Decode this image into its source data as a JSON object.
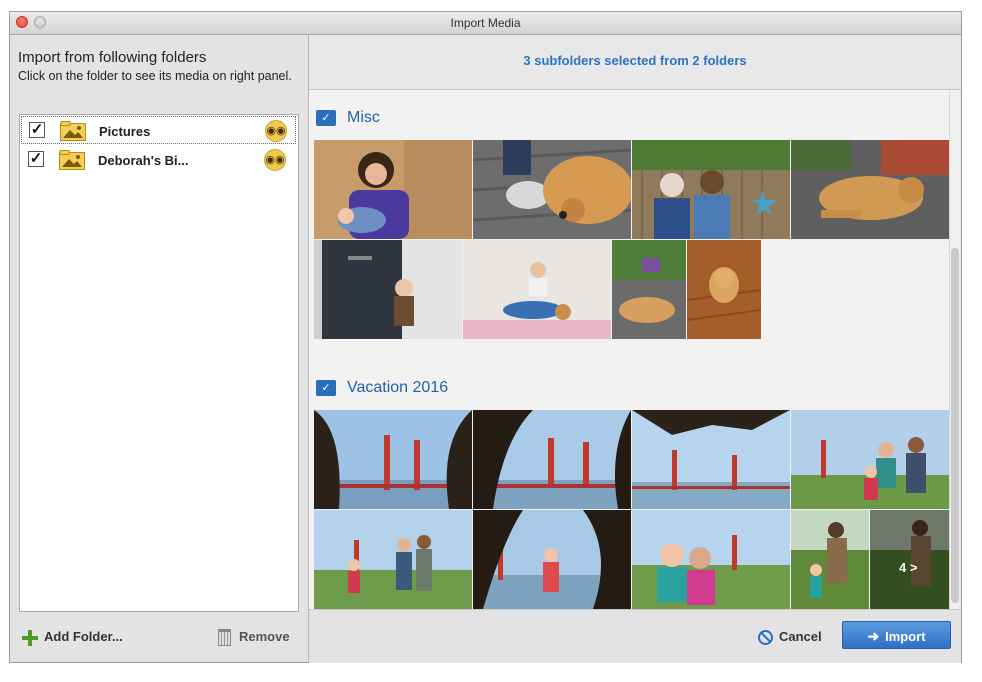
{
  "window": {
    "title": "Import Media"
  },
  "left_panel": {
    "heading": "Import from following folders",
    "subheading": "Click on the folder to see its media on right panel.",
    "folders": [
      {
        "name": "Pictures",
        "checked": true,
        "selected": true,
        "check_glyph": "✓"
      },
      {
        "name": "Deborah's Bi...",
        "checked": true,
        "selected": false,
        "check_glyph": "✓"
      }
    ],
    "folder_icon": "folder-image-icon",
    "action_icon": "binoculars-icon",
    "add_folder_label": "Add Folder...",
    "remove_label": "Remove"
  },
  "right_panel": {
    "summary": "3 subfolders selected from 2 folders",
    "sections": [
      {
        "title": "Misc",
        "icon": "folder-check-icon",
        "photo_count_shown": 8
      },
      {
        "title": "Vacation 2016",
        "icon": "folder-check-icon",
        "photo_count_shown": 13
      }
    ],
    "more_indicator": "4 >"
  },
  "footer": {
    "cancel_label": "Cancel",
    "import_label": "Import"
  },
  "colors": {
    "accent": "#2b73c4",
    "import_button": "#3d82d4",
    "binocular_badge": "#f2c94c"
  }
}
